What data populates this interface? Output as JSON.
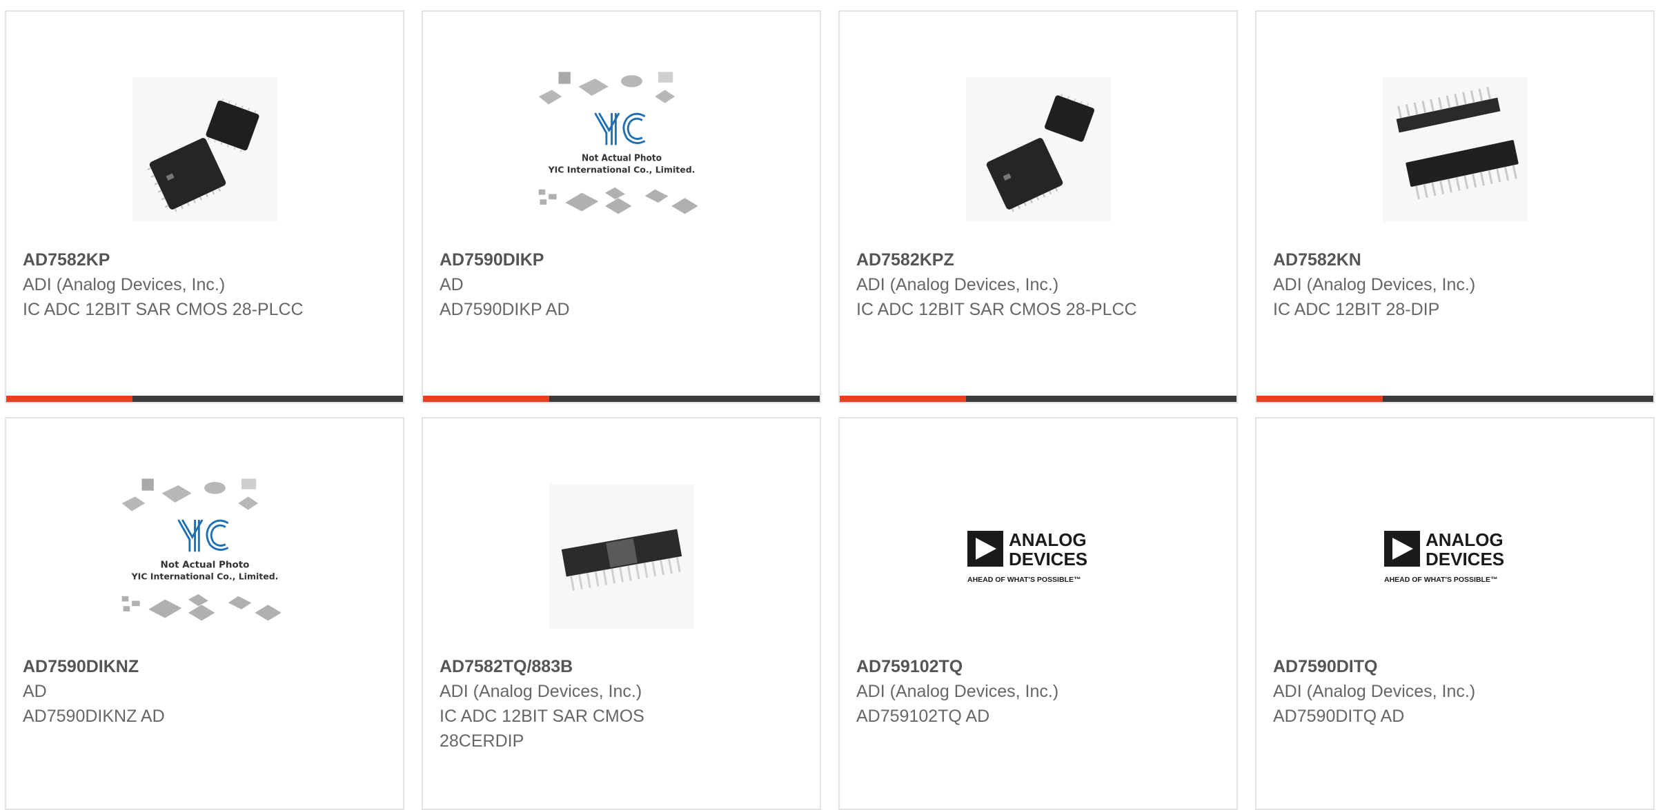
{
  "products": [
    {
      "part": "AD7582KP",
      "manufacturer": "ADI (Analog Devices, Inc.)",
      "description": "IC ADC 12BIT SAR CMOS 28-PLCC",
      "image": "plcc-chip-image"
    },
    {
      "part": "AD7590DIKP",
      "manufacturer": "AD",
      "description": "AD7590DIKP AD",
      "image": "yic-placeholder-image",
      "placeholder_line1": "Not Actual Photo",
      "placeholder_line2": "YIC International Co., Limited."
    },
    {
      "part": "AD7582KPZ",
      "manufacturer": "ADI (Analog Devices, Inc.)",
      "description": "IC ADC 12BIT SAR CMOS 28-PLCC",
      "image": "plcc-chip-image"
    },
    {
      "part": "AD7582KN",
      "manufacturer": "ADI (Analog Devices, Inc.)",
      "description": "IC ADC 12BIT 28-DIP",
      "image": "dip-chip-image"
    },
    {
      "part": "AD7590DIKNZ",
      "manufacturer": "AD",
      "description": "AD7590DIKNZ AD",
      "image": "yic-placeholder-image",
      "placeholder_line1": "Not Actual Photo",
      "placeholder_line2": "YIC International Co., Limited."
    },
    {
      "part": "AD7582TQ/883B",
      "manufacturer": "ADI (Analog Devices, Inc.)",
      "description": "IC ADC 12BIT SAR CMOS 28CERDIP",
      "image": "cerdip-chip-image"
    },
    {
      "part": "AD759102TQ",
      "manufacturer": "ADI (Analog Devices, Inc.)",
      "description": "AD759102TQ AD",
      "image": "analog-devices-logo",
      "logo_line1": "ANALOG",
      "logo_line2": "DEVICES",
      "logo_tagline": "AHEAD OF WHAT'S POSSIBLE™"
    },
    {
      "part": "AD7590DITQ",
      "manufacturer": "ADI (Analog Devices, Inc.)",
      "description": "AD7590DITQ AD",
      "image": "analog-devices-logo",
      "logo_line1": "ANALOG",
      "logo_line2": "DEVICES",
      "logo_tagline": "AHEAD OF WHAT'S POSSIBLE™"
    }
  ],
  "colors": {
    "accent": "#e8411b",
    "bar": "#3b3b3b",
    "text": "#666666",
    "border": "#e3e3e3",
    "yic_blue": "#1f6fb2"
  }
}
